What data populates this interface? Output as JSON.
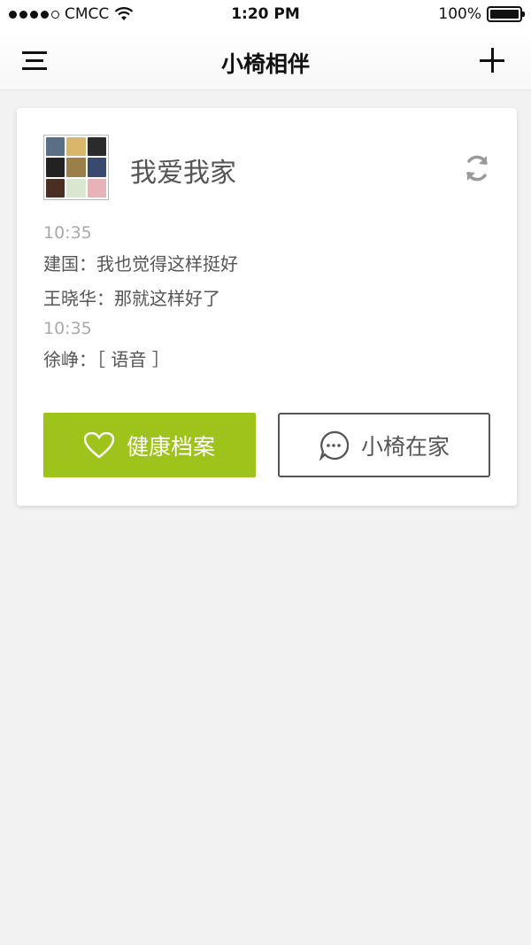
{
  "status_bar": {
    "carrier": "CMCC",
    "time": "1:20 PM",
    "battery": "100%"
  },
  "nav": {
    "title": "小椅相伴",
    "menu_icon": "menu-icon",
    "add_icon": "plus-icon"
  },
  "group": {
    "name": "我爱我家",
    "refresh_icon": "refresh-icon",
    "messages": [
      {
        "time": "10:35",
        "lines": [
          "建国：我也觉得这样挺好",
          "王晓华：那就这样好了"
        ]
      },
      {
        "time": "10:35",
        "lines": [
          "徐峥：［ 语音 ］"
        ]
      }
    ]
  },
  "actions": {
    "health_label": "健康档案",
    "home_label": "小椅在家"
  },
  "colors": {
    "accent": "#9ec31b",
    "background": "#f2f2f2"
  }
}
